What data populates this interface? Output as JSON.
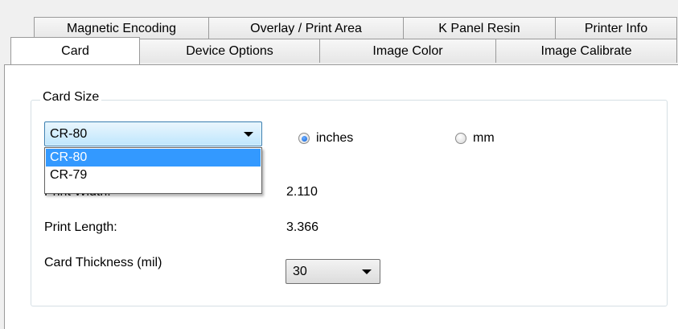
{
  "tabs_top": [
    {
      "label": "Magnetic Encoding"
    },
    {
      "label": "Overlay / Print Area"
    },
    {
      "label": "K Panel Resin"
    },
    {
      "label": "Printer Info"
    }
  ],
  "tabs_bottom": [
    {
      "label": "Card",
      "active": true
    },
    {
      "label": "Device Options"
    },
    {
      "label": "Image Color"
    },
    {
      "label": "Image Calibrate"
    }
  ],
  "card_size": {
    "group_label": "Card Size",
    "selected": "CR-80",
    "options": [
      "CR-80",
      "CR-79"
    ]
  },
  "units": {
    "inches_label": "inches",
    "mm_label": "mm",
    "selected": "inches"
  },
  "print_width": {
    "label": "Print Width:",
    "value": "2.110"
  },
  "print_length": {
    "label": "Print Length:",
    "value": "3.366"
  },
  "card_thickness": {
    "label": "Card Thickness (mil)",
    "selected": "30"
  }
}
